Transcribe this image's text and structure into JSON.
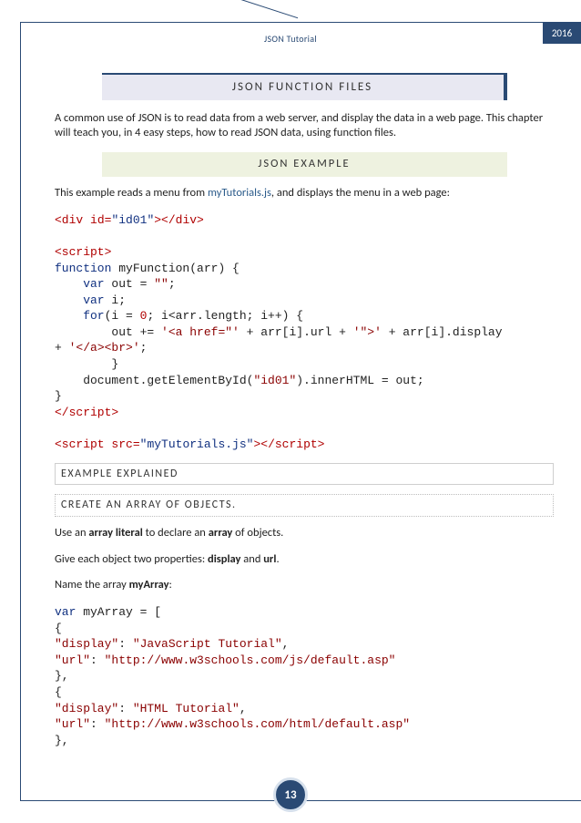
{
  "header": {
    "year": "2016",
    "doc_title": "JSON Tutorial"
  },
  "sections": {
    "main_banner": "JSON FUNCTION FILES",
    "intro": "A common use of JSON is to read data from a web server, and display the data in a web page. This chapter will teach you, in 4 easy steps, how to read JSON data, using function files.",
    "example_banner": "JSON EXAMPLE",
    "example_intro_a": "This example reads a menu from ",
    "example_intro_link": "myTutorials.js",
    "example_intro_b": ", and displays the menu in a web page:",
    "explained_label": "EXAMPLE EXPLAINED",
    "create_array_label": "CREATE AN ARRAY OF OBJECTS.",
    "p1_a": "Use an ",
    "p1_b": "array literal",
    "p1_c": " to declare an ",
    "p1_d": "array",
    "p1_e": " of objects.",
    "p2_a": "Give each object two properties: ",
    "p2_b": "display",
    "p2_c": " and ",
    "p2_d": "url",
    "p2_e": ".",
    "p3_a": "Name the array ",
    "p3_b": "myArray",
    "p3_c": ":"
  },
  "code1": {
    "l1_a": "<div ",
    "l1_b": "id",
    "l1_c": "=",
    "l1_d": "\"id01\"",
    "l1_e": "></div>",
    "l2": "<script>",
    "l3_a": "function",
    "l3_b": " myFunction(arr) {",
    "l4_a": "    var",
    "l4_b": " out = ",
    "l4_c": "\"\"",
    "l4_d": ";",
    "l5_a": "    var",
    "l5_b": " i;",
    "l6_a": "    for",
    "l6_b": "(i = ",
    "l6_c": "0",
    "l6_d": "; i<arr.length; i++) {",
    "l7_a": "        out += ",
    "l7_b": "'<a href=\"'",
    "l7_c": " + arr[i].url + ",
    "l7_d": "'\">'",
    "l7_e": " + arr[i].display",
    "l8_a": "+ ",
    "l8_b": "'</a><br>'",
    "l8_c": ";",
    "l9": "        }",
    "l10_a": "    document.getElementById(",
    "l10_b": "\"id01\"",
    "l10_c": ").innerHTML = out;",
    "l11": "}",
    "l12": "</script>",
    "l13_a": "<script ",
    "l13_b": "src",
    "l13_c": "=",
    "l13_d": "\"myTutorials.js\"",
    "l13_e": "></script>"
  },
  "code2": {
    "l1_a": "var",
    "l1_b": " myArray = [",
    "l2": "{",
    "l3_a": "\"display\"",
    "l3_b": ": ",
    "l3_c": "\"JavaScript Tutorial\"",
    "l3_d": ",",
    "l4_a": "\"url\"",
    "l4_b": ": ",
    "l4_c": "\"http://www.w3schools.com/js/default.asp\"",
    "l5": "},",
    "l6": "{",
    "l7_a": "\"display\"",
    "l7_b": ": ",
    "l7_c": "\"HTML Tutorial\"",
    "l7_d": ",",
    "l8_a": "\"url\"",
    "l8_b": ": ",
    "l8_c": "\"http://www.w3schools.com/html/default.asp\"",
    "l9": "},"
  },
  "footer": {
    "page_number": "13"
  }
}
